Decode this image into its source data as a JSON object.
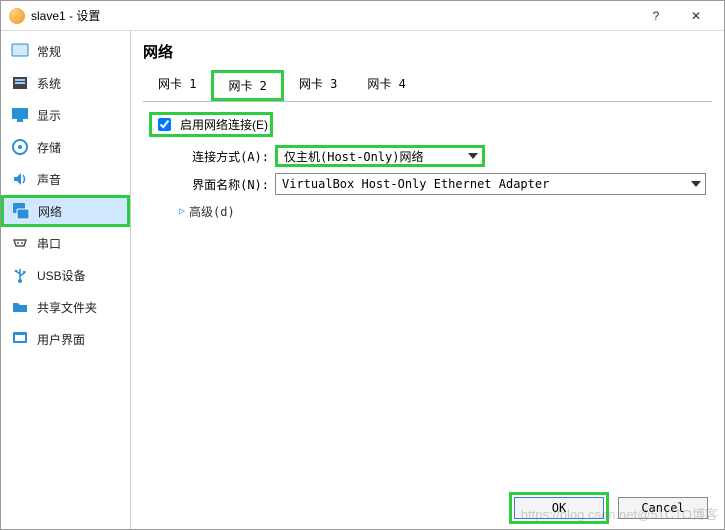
{
  "window": {
    "title": "slave1 - 设置"
  },
  "sidebar": {
    "items": [
      {
        "label": "常规"
      },
      {
        "label": "系统"
      },
      {
        "label": "显示"
      },
      {
        "label": "存储"
      },
      {
        "label": "声音"
      },
      {
        "label": "网络"
      },
      {
        "label": "串口"
      },
      {
        "label": "USB设备"
      },
      {
        "label": "共享文件夹"
      },
      {
        "label": "用户界面"
      }
    ]
  },
  "main": {
    "heading": "网络",
    "tabs": [
      {
        "label": "网卡 1"
      },
      {
        "label": "网卡 2"
      },
      {
        "label": "网卡 3"
      },
      {
        "label": "网卡 4"
      }
    ],
    "enable_label": "启用网络连接(E)",
    "attach_label": "连接方式(A):",
    "attach_value": "仅主机(Host-Only)网络",
    "iface_label": "界面名称(N):",
    "iface_value": "VirtualBox Host-Only Ethernet Adapter",
    "advanced_label": "高级(d)"
  },
  "buttons": {
    "ok": "OK",
    "cancel": "Cancel"
  },
  "watermark": "https://blog.csdn.net@51CTO博客"
}
